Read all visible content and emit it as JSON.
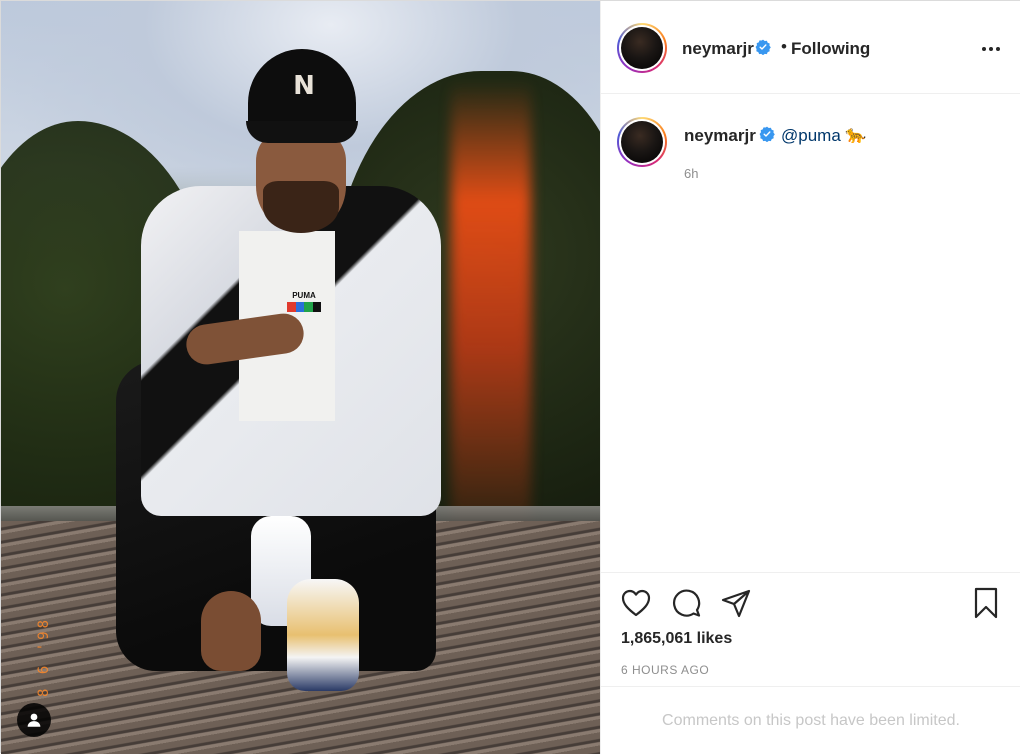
{
  "post": {
    "photo": {
      "date_stamp": "8 6 '98",
      "icon": "user-tag-icon",
      "puma_text": "PUMA",
      "stripe_colors": [
        "#e03a2e",
        "#2a6fdb",
        "#22a34a",
        "#111111"
      ]
    },
    "header": {
      "username": "neymarjr",
      "separator": "•",
      "following_label": "Following",
      "verified_icon": "verified-badge-icon",
      "more_icon": "more-options-icon"
    },
    "caption": {
      "username": "neymarjr",
      "mention": "@puma",
      "emoji": "🐆",
      "time": "6h"
    },
    "actions": {
      "like_icon": "heart-icon",
      "comment_icon": "comment-icon",
      "share_icon": "share-icon",
      "save_icon": "bookmark-icon"
    },
    "likes": "1,865,061 likes",
    "timestamp": "6 HOURS AGO",
    "comments_notice": "Comments on this post have been limited.",
    "colors": {
      "verified": "#3897f0",
      "mention": "#00376b",
      "muted": "#8e8e8e",
      "border": "#efefef"
    }
  }
}
